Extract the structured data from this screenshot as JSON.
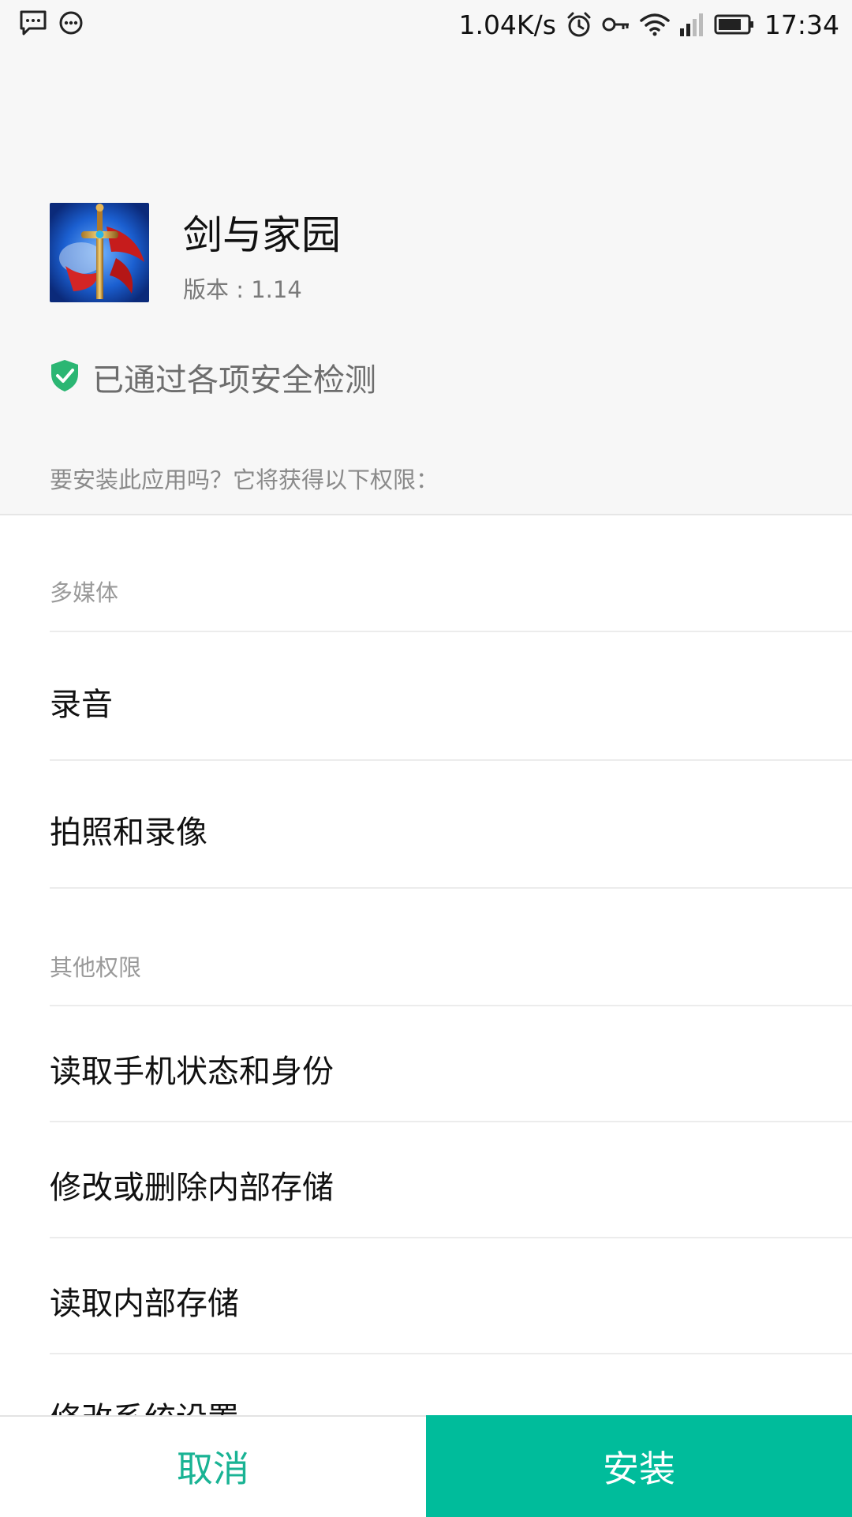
{
  "status_bar": {
    "net_speed": "1.04K/s",
    "time": "17:34",
    "left_icons": [
      "message-icon",
      "more-dots-icon"
    ],
    "right_icons": [
      "alarm-icon",
      "key-vpn-icon",
      "wifi-icon",
      "signal-icon",
      "battery-icon"
    ]
  },
  "app": {
    "name": "剑与家园",
    "version": "版本 : 1.14",
    "icon": "app-game-icon"
  },
  "security": {
    "text": "已通过各项安全检测",
    "icon": "shield-check-icon",
    "color": "#2bb673"
  },
  "install_prompt": "要安装此应用吗？它将获得以下权限：",
  "sections": [
    {
      "title": "多媒体",
      "items": [
        "录音",
        "拍照和录像"
      ]
    },
    {
      "title": "其他权限",
      "items": [
        "读取手机状态和身份",
        "修改或删除内部存储",
        "读取内部存储",
        "修改系统设置"
      ]
    }
  ],
  "buttons": {
    "cancel": "取消",
    "install": "安装",
    "accent_color": "#00bc9b"
  }
}
